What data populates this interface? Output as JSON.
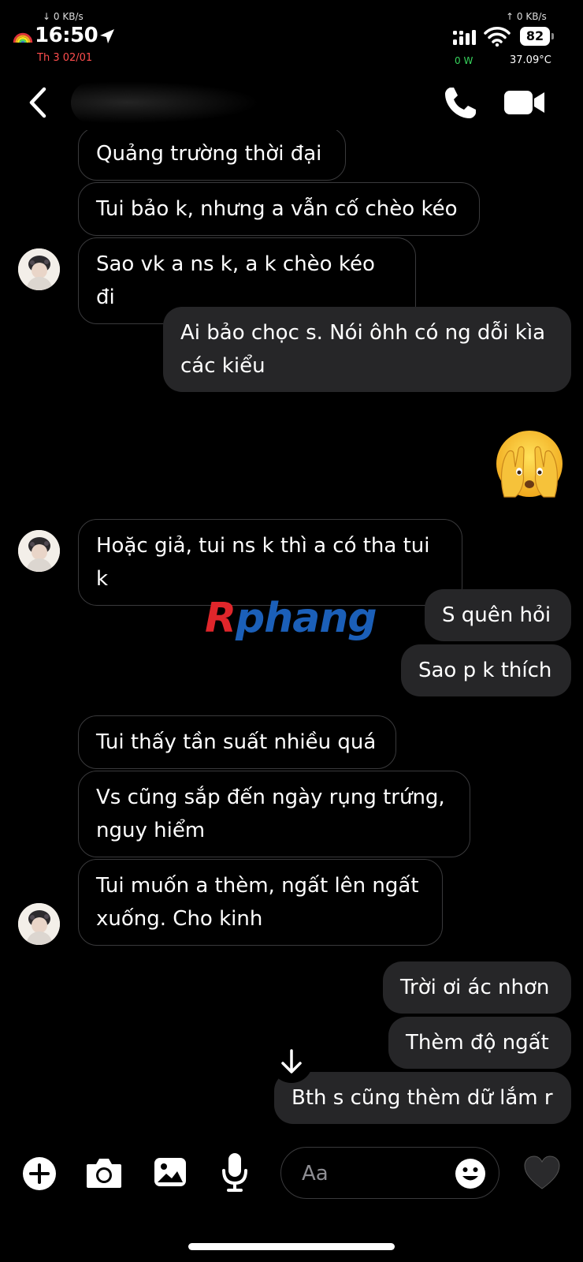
{
  "status_bar": {
    "net_down": "↓ 0 KB/s",
    "net_up": "↑ 0 KB/s",
    "time": "16:50",
    "date": "Th 3 02/01",
    "battery": "82",
    "power": "0 W",
    "temperature": "37.09°C",
    "icons": [
      "rainbow-icon",
      "location-arrow-icon",
      "signal-icon",
      "wifi-icon",
      "battery-icon"
    ]
  },
  "header": {
    "icons": [
      "back-icon",
      "phone-icon",
      "video-camera-icon"
    ]
  },
  "messages": [
    {
      "direction": "in",
      "text": "Quảng trường thời đại"
    },
    {
      "direction": "in",
      "text": "Tui bảo k, nhưng a vẫn cố chèo kéo"
    },
    {
      "direction": "in",
      "text": "Sao vk a ns k, a k chèo kéo đi"
    },
    {
      "direction": "out",
      "text": "Ai bảo chọc s. Nói ôhh có ng dỗi kìa các kiểu"
    },
    {
      "direction": "out",
      "emoji": "face-with-hands-over-eyes-emoji"
    },
    {
      "direction": "in",
      "text": "Hoặc giả, tui ns k thì a có tha tui k"
    },
    {
      "direction": "out",
      "text": "S quên hỏi"
    },
    {
      "direction": "out",
      "text": "Sao p k thích"
    },
    {
      "direction": "in",
      "text": "Tui thấy tần suất nhiều quá"
    },
    {
      "direction": "in",
      "text": "Vs cũng sắp đến ngày rụng trứng, nguy hiểm"
    },
    {
      "direction": "in",
      "text": "Tui muốn a thèm, ngất lên ngất xuống. Cho kinh"
    },
    {
      "direction": "out",
      "text": "Trời ơi ác nhơn"
    },
    {
      "direction": "out",
      "text": "Thèm độ ngất"
    },
    {
      "direction": "out",
      "text": "Bth s cũng thèm dữ lắm r"
    }
  ],
  "watermark": {
    "r": "R",
    "rest": "phang"
  },
  "composer": {
    "placeholder": "Aa",
    "icons": [
      "plus-icon",
      "camera-icon",
      "image-icon",
      "microphone-icon",
      "emoji-icon",
      "heart-icon"
    ]
  },
  "colors": {
    "background": "#000000",
    "outgoing_bubble": "#262628",
    "incoming_border": "#3a3a3c",
    "date_red": "#ff4d4d",
    "power_green": "#37d35c"
  }
}
